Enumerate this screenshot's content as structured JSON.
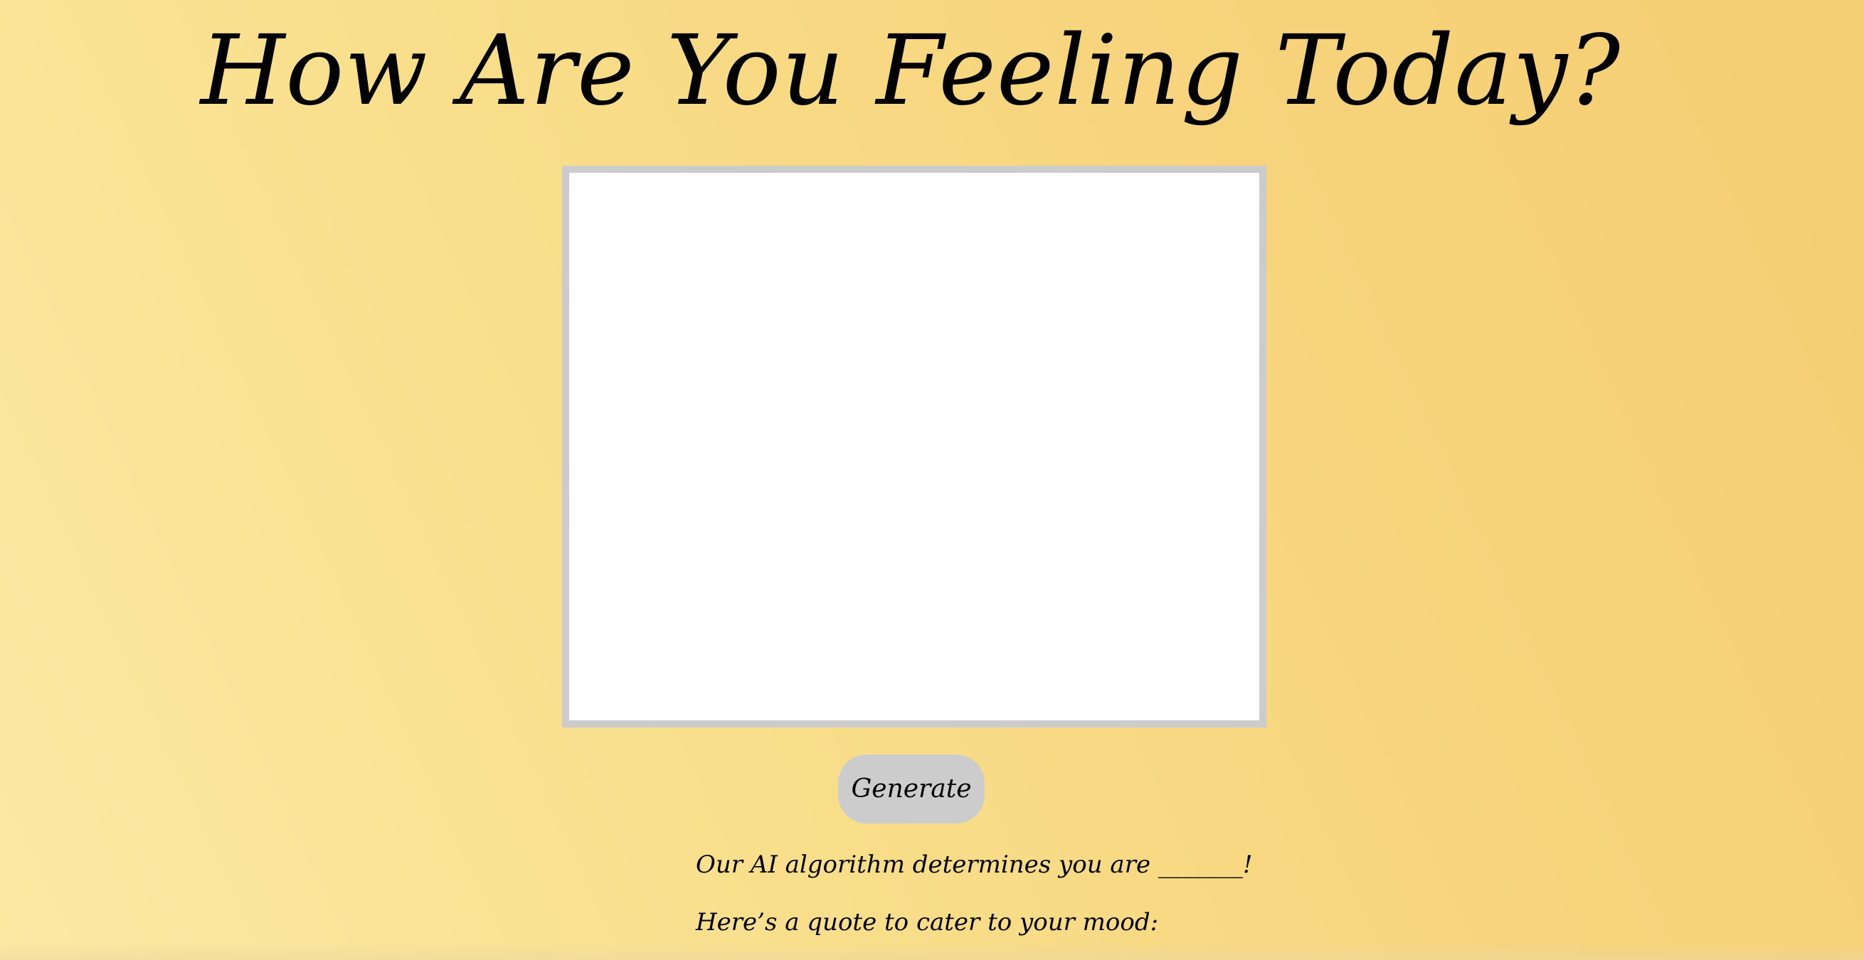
{
  "header": {
    "title": "How Are You Feeling Today?"
  },
  "webcam": {
    "background": "#ffffff",
    "border_color": "#cccccc"
  },
  "actions": {
    "generate_label": "Generate"
  },
  "result": {
    "mood_text": "Our AI algorithm determines you are _______!",
    "quote_intro": "Here’s a quote to cater to your mood:"
  },
  "theme": {
    "background_gradient": [
      "#fbe9a3",
      "#f5cd72"
    ],
    "button_color": "#cccccc",
    "text_color": "#000000"
  }
}
